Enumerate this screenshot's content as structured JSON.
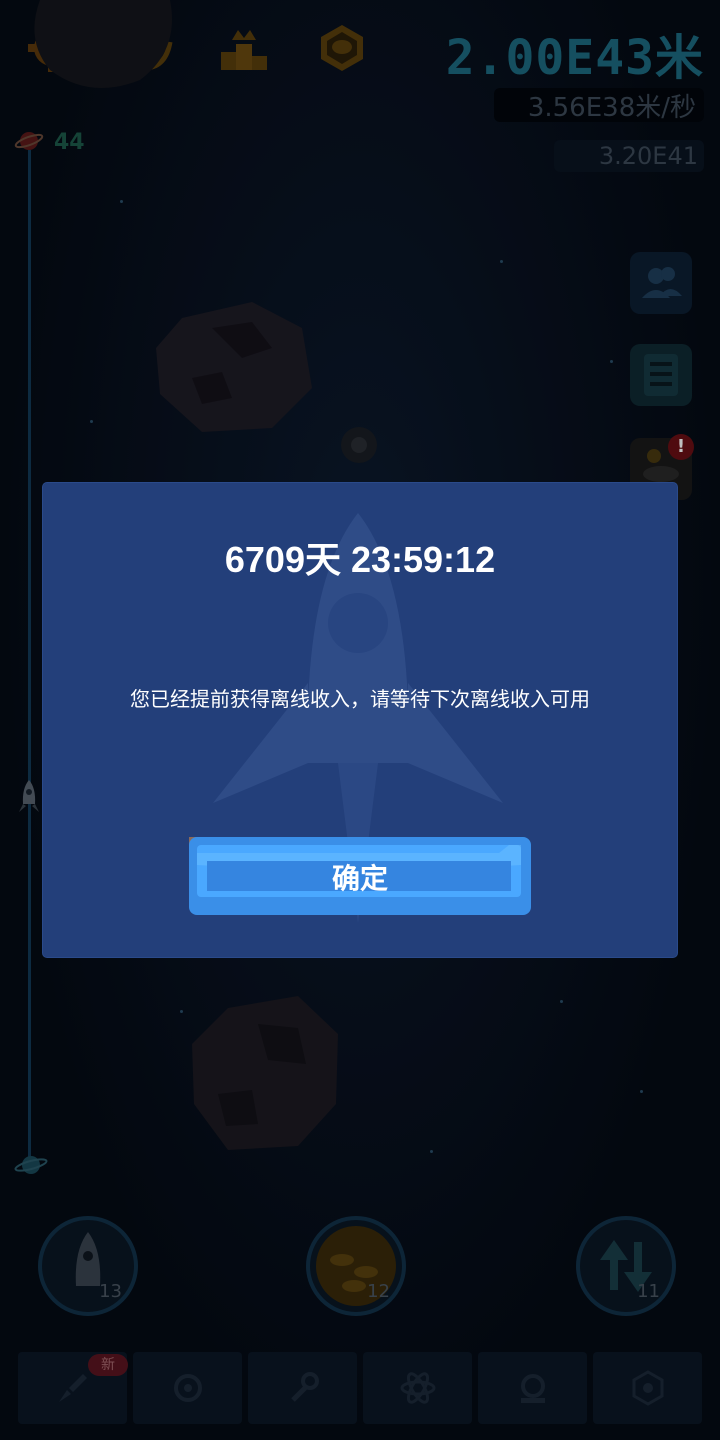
{
  "hud": {
    "distance": "2.00E43米",
    "speed": "3.56E38米/秒",
    "coins": "3.20E41",
    "level": "44"
  },
  "round_buttons": [
    {
      "name": "rocket",
      "count": "13"
    },
    {
      "name": "coins",
      "count": "12"
    },
    {
      "name": "swap",
      "count": "11"
    }
  ],
  "bottom_nav": {
    "new_badge": "新"
  },
  "side_alert": "!",
  "dialog": {
    "time": "6709天 23:59:12",
    "message": "您已经提前获得离线收入，请等待下次离线收入可用",
    "confirm_label": "确定"
  },
  "colors": {
    "dialog_bg": "#233f7a",
    "button_blue": "#3a8fe8",
    "button_brown": "#8a6a5a"
  }
}
